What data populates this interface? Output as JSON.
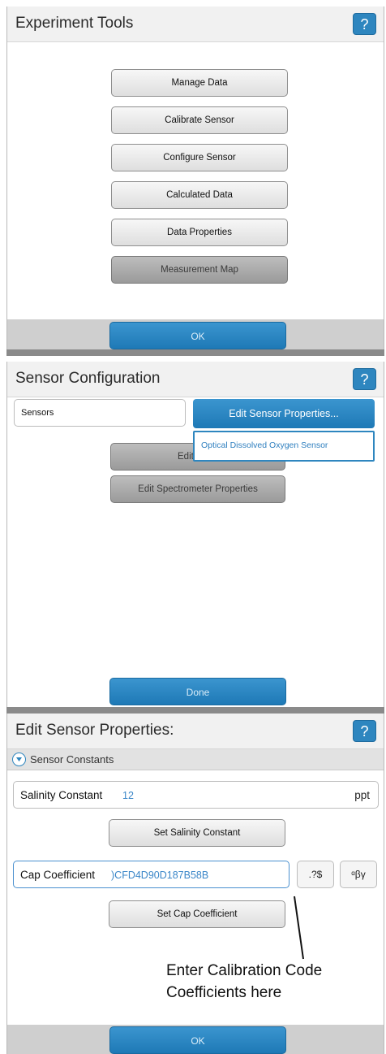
{
  "experiment_tools": {
    "title": "Experiment Tools",
    "help_label": "?",
    "buttons": [
      "Manage Data",
      "Calibrate Sensor",
      "Configure Sensor",
      "Calculated Data",
      "Data Properties"
    ],
    "measurement_map": "Measurement Map",
    "ok_label": "OK"
  },
  "sensor_config": {
    "title": "Sensor Configuration",
    "help_label": "?",
    "sensors_label": "Sensors",
    "edit_sensor_props": "Edit Sensor Properties...",
    "edit_time_partial": "Edit Time",
    "dropdown_item": "Optical Dissolved Oxygen Sensor",
    "edit_spectrometer": "Edit Spectrometer Properties",
    "done_label": "Done"
  },
  "edit_sensor_props": {
    "title": "Edit Sensor Properties:",
    "help_label": "?",
    "section_label": "Sensor Constants",
    "salinity_label": "Salinity Constant",
    "salinity_value": "12",
    "salinity_unit": "ppt",
    "set_salinity": "Set Salinity Constant",
    "cap_label": "Cap Coefficient",
    "cap_value": ")CFD4D90D187B58B",
    "key_btn_1": ".?$",
    "key_btn_2": "ᵅβγ",
    "set_cap": "Set Cap Coefficient",
    "ok_label": "OK"
  },
  "annotation": {
    "line1": "Enter Calibration Code",
    "line2": "Coefficients here"
  },
  "colors": {
    "accent": "#2e86bf",
    "value_text": "#3a86c8"
  }
}
